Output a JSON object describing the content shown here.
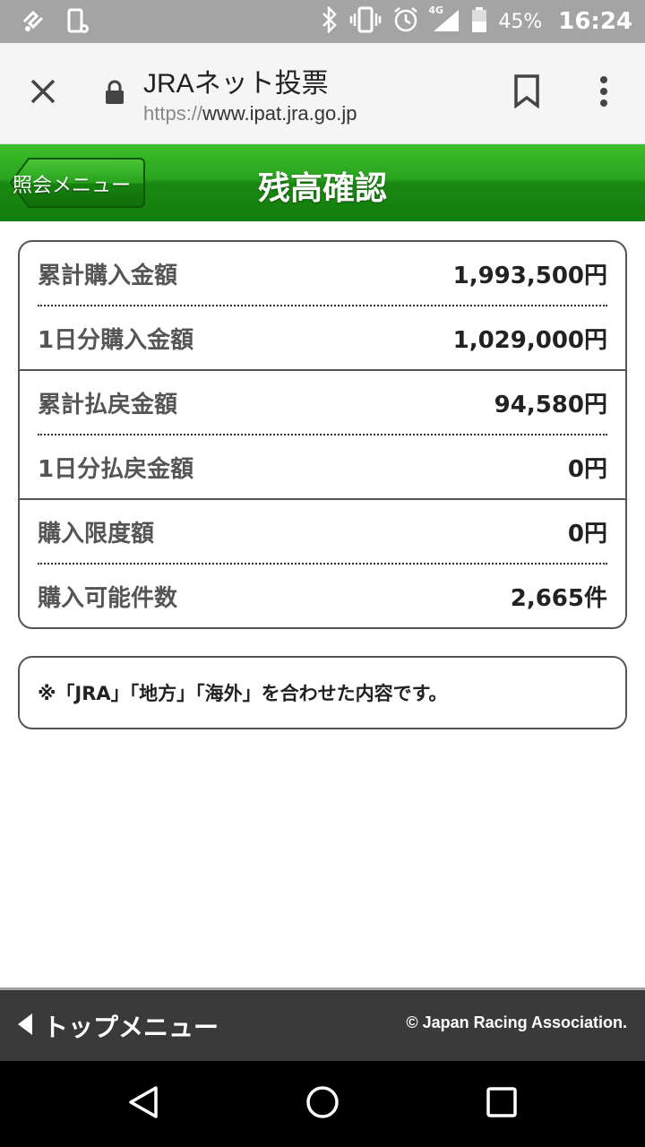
{
  "status_bar": {
    "battery": "45%",
    "clock": "16:24",
    "network": "4G",
    "icons": [
      "app-notification-icon",
      "device-settings-icon",
      "bluetooth-icon",
      "vibrate-icon",
      "alarm-icon",
      "signal-icon",
      "battery-icon"
    ]
  },
  "browser": {
    "title": "JRAネット投票",
    "url_scheme": "https://",
    "url_host": "www.ipat.jra.go.jp"
  },
  "header": {
    "back_label": "照会メニュー",
    "title": "残高確認"
  },
  "balance": {
    "groups": [
      [
        {
          "label": "累計購入金額",
          "value": "1,993,500円"
        },
        {
          "label": "1日分購入金額",
          "value": "1,029,000円"
        }
      ],
      [
        {
          "label": "累計払戻金額",
          "value": "94,580円"
        },
        {
          "label": "1日分払戻金額",
          "value": "0円"
        }
      ],
      [
        {
          "label": "購入限度額",
          "value": "0円"
        },
        {
          "label": "購入可能件数",
          "value": "2,665件"
        }
      ]
    ]
  },
  "note": "※「JRA」「地方」「海外」を合わせた内容です。",
  "footer": {
    "top_menu_label": "トップメニュー",
    "copyright": "© Japan Racing Association."
  },
  "colors": {
    "header_green": "#1a8a12",
    "footer_bg": "#3a3a3a",
    "status_bar_bg": "#a4a4a4"
  }
}
